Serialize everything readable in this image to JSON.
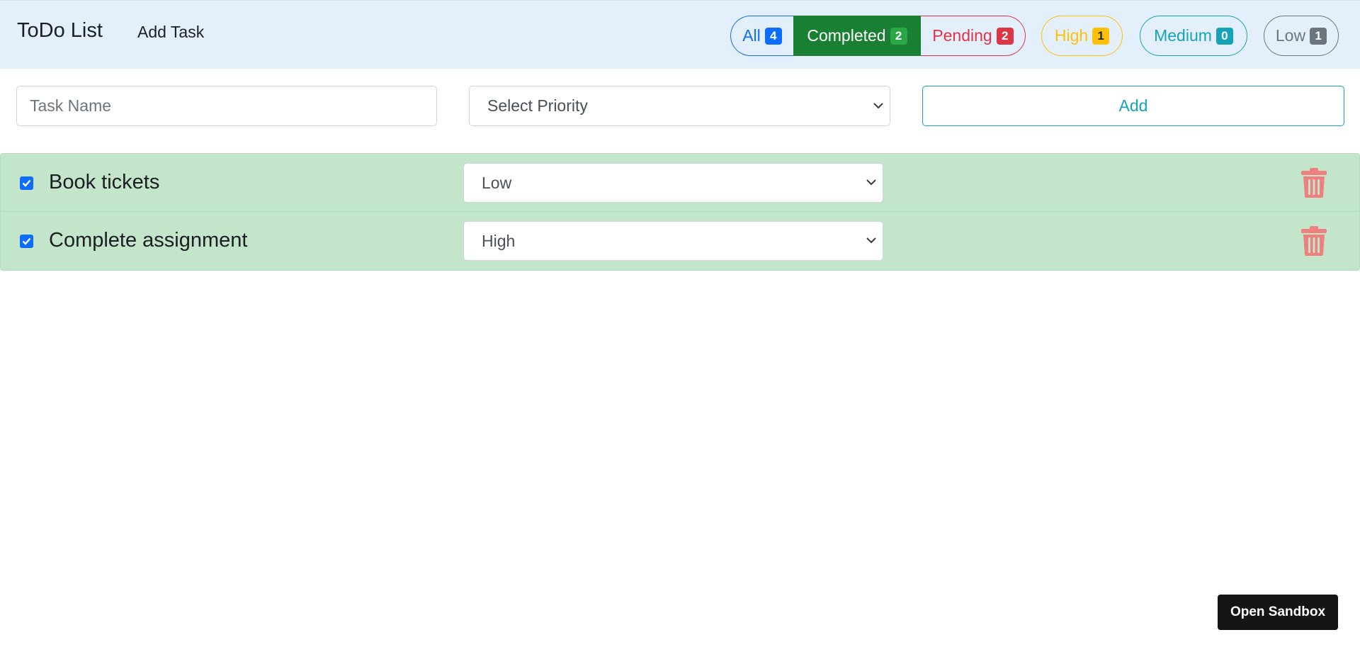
{
  "navbar": {
    "brand": "ToDo List",
    "add_task_link": "Add Task"
  },
  "filters": {
    "all": {
      "label": "All",
      "count": "4",
      "color": "#0d6efd"
    },
    "completed": {
      "label": "Completed",
      "count": "2",
      "color": "#198033",
      "active": true
    },
    "pending": {
      "label": "Pending",
      "count": "2",
      "color": "#dc3545"
    },
    "high": {
      "label": "High",
      "count": "1",
      "color": "#ffc107"
    },
    "medium": {
      "label": "Medium",
      "count": "0",
      "color": "#17a2b8"
    },
    "low": {
      "label": "Low",
      "count": "1",
      "color": "#6c757d"
    }
  },
  "form": {
    "task_name_placeholder": "Task Name",
    "priority_placeholder": "Select Priority",
    "add_label": "Add"
  },
  "tasks": [
    {
      "name": "Book tickets",
      "priority": "Low",
      "completed": true
    },
    {
      "name": "Complete assignment",
      "priority": "High",
      "completed": true
    }
  ],
  "colors": {
    "completed_row": "#c3e6cb",
    "navbar_bg": "#e3f0fb",
    "delete_icon": "#f08080"
  },
  "sandbox_button": "Open Sandbox"
}
